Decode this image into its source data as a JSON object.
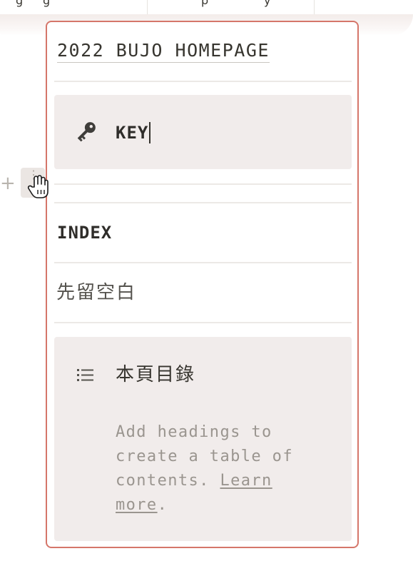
{
  "top_table": {
    "cells": [
      "g",
      "g",
      "p",
      "y"
    ]
  },
  "card": {
    "page_link": "2022 BUJO HOMEPAGE",
    "key_callout": {
      "icon": "key-icon",
      "text": "KEY"
    },
    "index_heading": "INDEX",
    "placeholder_text": "先留空白",
    "toc": {
      "icon": "bulleted-list-icon",
      "title": "本頁目錄",
      "hint": "Add headings to create a table of contents.",
      "learn_more": "Learn more",
      "period": "."
    }
  },
  "colors": {
    "card_border": "#d5766a",
    "callout_bg": "#f1eceb",
    "text": "#37352f",
    "muted": "#9a958f"
  }
}
